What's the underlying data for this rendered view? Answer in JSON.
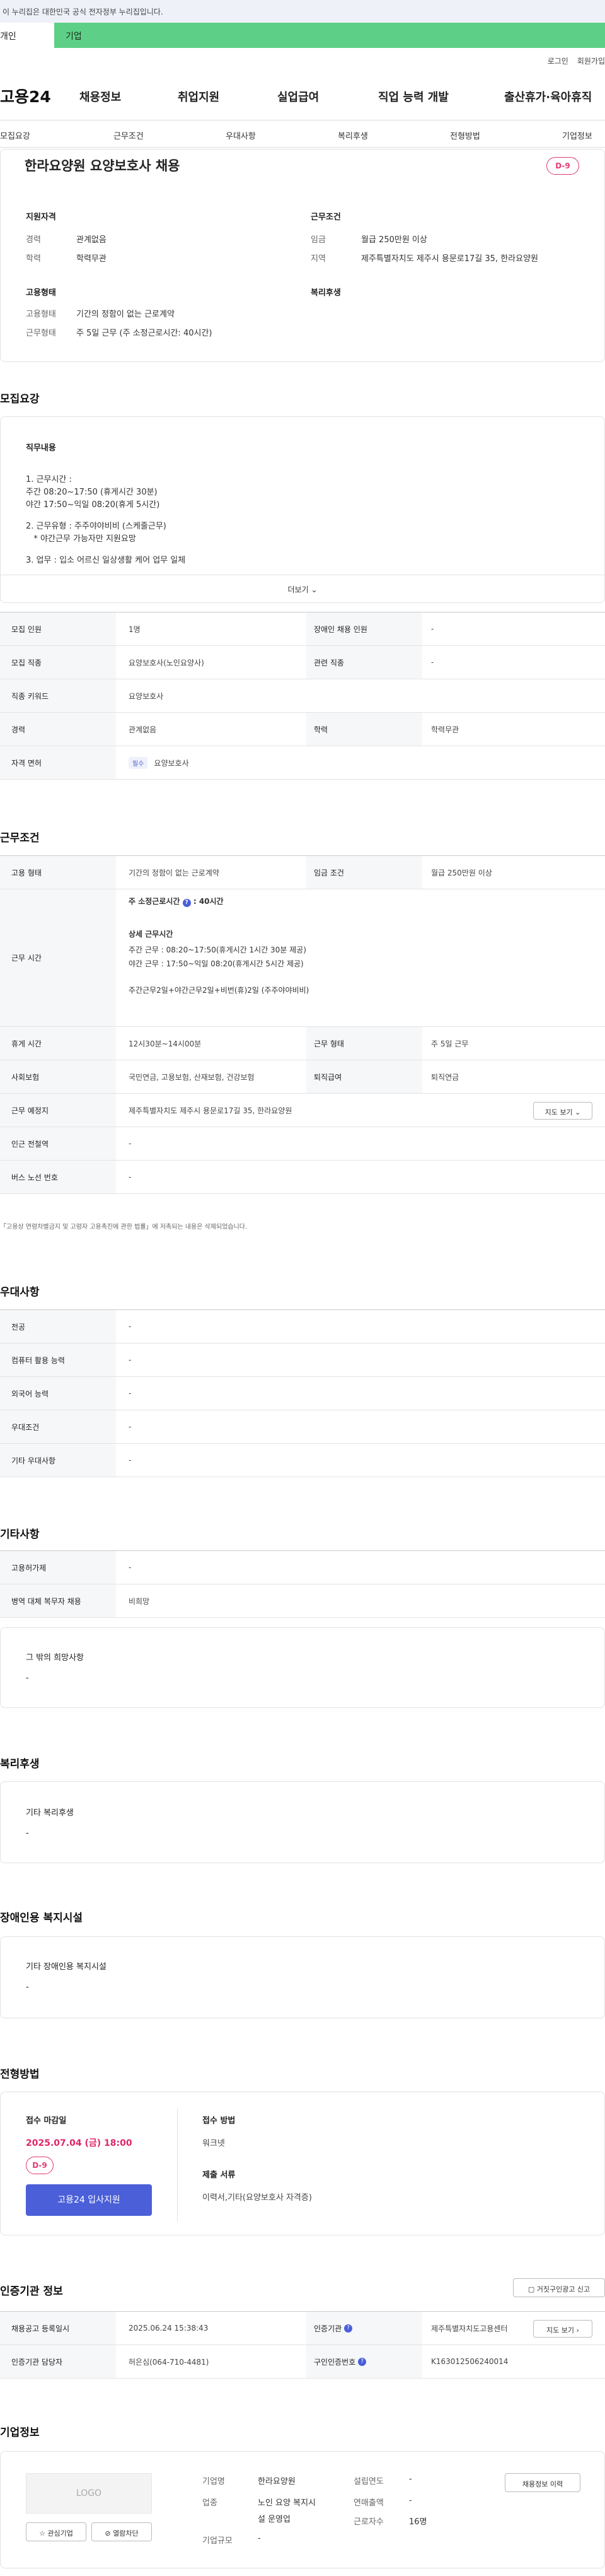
{
  "gov_banner": "이 누리집은 대한민국 공식 전자정부 누리집입니다.",
  "tabs": [
    "개인",
    "기업"
  ],
  "util": [
    "로그인",
    "회원가입"
  ],
  "logo": "고용24",
  "gnb": [
    "채용정보",
    "취업지원",
    "실업급여",
    "직업 능력 개발",
    "출산휴가·육아휴직"
  ],
  "subnav": [
    "모집요강",
    "근무조건",
    "우대사항",
    "복리후생",
    "전형방법",
    "기업정보"
  ],
  "job": {
    "title": "한라요양원 요양보호사 채용",
    "dday": "D-9",
    "qual_head": "지원자격",
    "career_lbl": "경력",
    "career": "관계없음",
    "edu_lbl": "학력",
    "edu": "학력무관",
    "cond_head": "근무조건",
    "wage_lbl": "임금",
    "wage": "월급 250만원 이상",
    "region_lbl": "지역",
    "region": "제주특별자치도 제주시 용문로17길 35, 한라요양원",
    "emp_head": "고용형태",
    "emp_type_lbl": "고용형태",
    "emp_type": "기간의 정함이 없는 근로계약",
    "work_lbl": "근무형태",
    "work": "주 5일 근무 (주 소정근로시간: 40시간)",
    "welfare_head": "복리후생"
  },
  "recruit": {
    "heading": "모집요강",
    "duty_head": "직무내용",
    "lines": [
      "1. 근무시간 :",
      "주간 08:20~17:50 (휴게시간 30분)",
      "야간 17:50~익일 08:20(휴게 5시간)",
      "",
      "2. 근무유형 : 주주야야비비 (스케줄근무)",
      "   * 야간근무 가능자만 지원요망",
      "",
      "3. 업무 : 입소 어르신 일상생활 케어 업무 일체"
    ],
    "more": "더보기",
    "rows": [
      {
        "k": "모집 인원",
        "v": "1명",
        "k2": "장애인 채용 인원",
        "v2": "-"
      },
      {
        "k": "모집 직종",
        "v": "요양보호사(노인요양사)",
        "k2": "관련 직종",
        "v2": "-"
      },
      {
        "k": "직종 키워드",
        "v": "요양보호사",
        "k2": "",
        "v2": ""
      },
      {
        "k": "경력",
        "v": "관계없음",
        "k2": "학력",
        "v2": "학력무관"
      },
      {
        "k": "자격 면허",
        "v": "요양보호사",
        "tag": "필수",
        "k2": "",
        "v2": ""
      }
    ]
  },
  "conditions": {
    "heading": "근무조건",
    "emp_k": "고용 형태",
    "emp_v": "기간의 정함이 없는 근로계약",
    "wage_k": "임금 조건",
    "wage_v": "월급 250만원 이상",
    "hours_k": "근무 시간",
    "hours_total": "주 소정근로시간",
    "hours_total_v": ": 40시간",
    "detail_head": "상세 근무시간",
    "detail": [
      "주간 근무 : 08:20~17:50(휴게시간 1시간 30분 제공)",
      "야간 근무 : 17:50~익일 08:20(휴게시간 5시간 제공)",
      "",
      "주간근무2일+야간근무2일+비번(휴)2일 (주주야야비비)"
    ],
    "rest_k": "휴게 시간",
    "rest_v": "12시30분~14시00분",
    "form_k": "근무 형태",
    "form_v": "주 5일 근무",
    "ins_k": "사회보험",
    "ins_v": "국민연금, 고용보험, 산재보험, 건강보험",
    "ret_k": "퇴직급여",
    "ret_v": "퇴직연금",
    "place_k": "근무 예정지",
    "place_v": "제주특별자치도 제주시 용문로17길 35, 한라요양원",
    "map_btn": "지도 보기",
    "sub_k": "인근 전철역",
    "sub_v": "-",
    "bus_k": "버스 노선 번호",
    "bus_v": "-",
    "note": "「고용상 연령차별금지 및 고령자 고용촉진에 관한 법률」에 저촉되는 내용은 삭제되었습니다."
  },
  "pref": {
    "heading": "우대사항",
    "rows": [
      {
        "k": "전공",
        "v": "-"
      },
      {
        "k": "컴퓨터 활용 능력",
        "v": "-"
      },
      {
        "k": "외국어 능력",
        "v": "-"
      },
      {
        "k": "우대조건",
        "v": "-"
      },
      {
        "k": "기타 우대사항",
        "v": "-"
      }
    ]
  },
  "etc": {
    "heading": "기타사항",
    "rows": [
      {
        "k": "고용허가제",
        "v": "-"
      },
      {
        "k": "병역 대체 복무자 채용",
        "v": "비희망"
      }
    ],
    "other_head": "그 밖의 희망사항",
    "other_v": "-"
  },
  "welfare": {
    "heading": "복리후생",
    "head": "기타 복리후생",
    "v": "-"
  },
  "disab": {
    "heading": "장애인용 복지시설",
    "head": "기타 장애인용 복지시설",
    "v": "-"
  },
  "process": {
    "heading": "전형방법",
    "deadline_head": "접수 마감일",
    "deadline": "2025.07.04 (금) 18:00",
    "dday": "D-9",
    "apply_btn": "고용24 입사지원",
    "method_head": "접수 방법",
    "method": "워크넷",
    "docs_head": "제출 서류",
    "docs": "이력서,기타(요양보호사 자격증)"
  },
  "cert": {
    "heading": "인증기관 정보",
    "report_btn": "거짓구인광고 신고",
    "reg_k": "채용공고 등록일시",
    "reg_v": "2025.06.24 15:38:43",
    "org_k": "인증기관",
    "org_v": "제주특별자치도고용센터",
    "mgr_k": "인증기관 담당자",
    "mgr_v": "허은심(064-710-4481)",
    "no_k": "구인인증번호",
    "no_v": "K163012506240014",
    "map_btn": "지도 보기"
  },
  "company": {
    "heading": "기업정보",
    "logo": "LOGO",
    "fav": "관심기업",
    "block": "열람차단",
    "name_k": "기업명",
    "name_v": "한라요양원",
    "ind_k": "업종",
    "ind_v1": "노인 요양 복지시",
    "ind_v2": "설 운영업",
    "size_k": "기업규모",
    "size_v": "-",
    "est_k": "설립연도",
    "est_v": "-",
    "sales_k": "연매출액",
    "sales_v": "-",
    "emp_k": "근로자수",
    "emp_v": "16명",
    "history_btn": "채용정보 이력"
  }
}
